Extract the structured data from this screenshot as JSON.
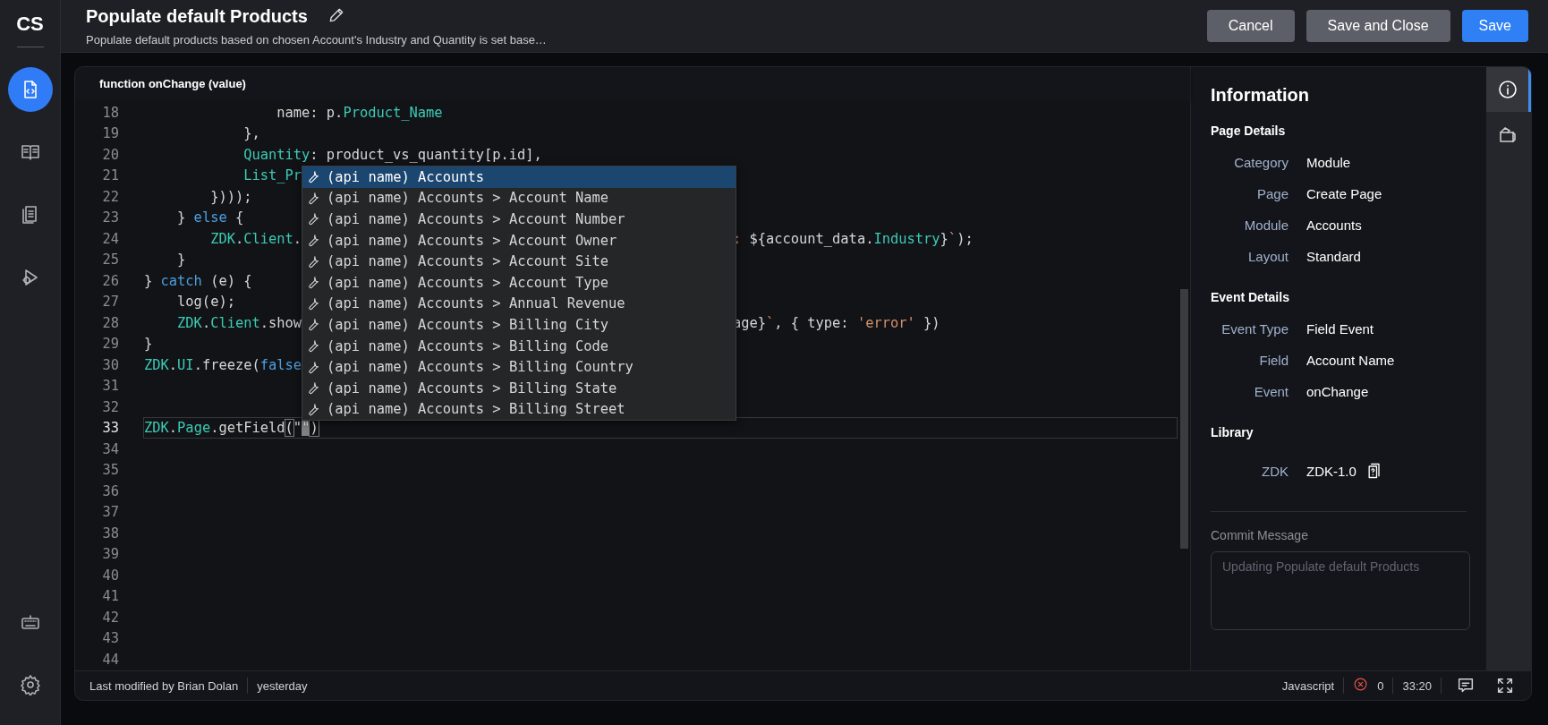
{
  "sidebar": {
    "logo": "CS",
    "items": [
      {
        "kind": "code",
        "selected": true
      },
      {
        "kind": "book",
        "selected": false
      },
      {
        "kind": "list",
        "selected": false
      },
      {
        "kind": "debug",
        "selected": false
      }
    ],
    "bottom_items": [
      {
        "kind": "keyboard"
      },
      {
        "kind": "settings"
      }
    ]
  },
  "header": {
    "title": "Populate default Products",
    "subtitle": "Populate default products based on chosen Account's Industry and Quantity is set base…",
    "buttons": [
      {
        "label": "Cancel",
        "kind": "secondary"
      },
      {
        "label": "Save and Close",
        "kind": "secondary"
      },
      {
        "label": "Save",
        "kind": "primary"
      }
    ]
  },
  "editor": {
    "signature": "function onChange (value)",
    "lines": [
      {
        "number": "18",
        "current": false,
        "before": [
          {
            "t": "                name: p.",
            "kind": "plain"
          },
          {
            "t": "Product_Name",
            "kind": "prop"
          }
        ]
      },
      {
        "number": "19",
        "current": false,
        "before": [
          {
            "t": "            },",
            "kind": "plain"
          }
        ]
      },
      {
        "number": "20",
        "current": false,
        "before": [
          {
            "t": "            Quantity",
            "kind": "prop"
          },
          {
            "t": ": product_vs_quantity[p.id],",
            "kind": "plain"
          }
        ]
      },
      {
        "number": "21",
        "current": false,
        "before": [
          {
            "t": "            List_Pr",
            "kind": "prop"
          }
        ]
      },
      {
        "number": "22",
        "current": false,
        "before": [
          {
            "t": "        })));",
            "kind": "plain"
          }
        ]
      },
      {
        "number": "23",
        "current": false,
        "before": [
          {
            "t": "    } ",
            "kind": "plain"
          },
          {
            "t": "else",
            "kind": "keyword"
          },
          {
            "t": " {",
            "kind": "plain"
          }
        ]
      },
      {
        "number": "24",
        "current": false,
        "before": [
          {
            "t": "        ZDK",
            "kind": "prop"
          },
          {
            "t": ".",
            "kind": "plain"
          },
          {
            "t": "Client",
            "kind": "prop"
          },
          {
            "t": ".",
            "kind": "plain"
          }
        ],
        "after": [
          {
            "t": ": ",
            "kind": "string"
          },
          {
            "t": "${account_data.",
            "kind": "plain"
          },
          {
            "t": "Industry",
            "kind": "prop"
          },
          {
            "t": "}",
            "kind": "plain"
          },
          {
            "t": "`",
            "kind": "string"
          },
          {
            "t": ");",
            "kind": "plain"
          }
        ]
      },
      {
        "number": "25",
        "current": false,
        "before": [
          {
            "t": "    }",
            "kind": "plain"
          }
        ]
      },
      {
        "number": "26",
        "current": false,
        "before": [
          {
            "t": "} ",
            "kind": "plain"
          },
          {
            "t": "catch",
            "kind": "keyword"
          },
          {
            "t": " (e) {",
            "kind": "plain"
          }
        ]
      },
      {
        "number": "27",
        "current": false,
        "before": [
          {
            "t": "    log(e);",
            "kind": "plain"
          }
        ]
      },
      {
        "number": "28",
        "current": false,
        "before": [
          {
            "t": "    ZDK",
            "kind": "prop"
          },
          {
            "t": ".",
            "kind": "plain"
          },
          {
            "t": "Client",
            "kind": "prop"
          },
          {
            "t": ".show",
            "kind": "plain"
          }
        ],
        "after": [
          {
            "t": "age}",
            "kind": "plain"
          },
          {
            "t": "`",
            "kind": "string"
          },
          {
            "t": ", { type: ",
            "kind": "plain"
          },
          {
            "t": "'error'",
            "kind": "string"
          },
          {
            "t": " })",
            "kind": "plain"
          }
        ]
      },
      {
        "number": "29",
        "current": false,
        "before": [
          {
            "t": "}",
            "kind": "plain"
          }
        ]
      },
      {
        "number": "30",
        "current": false,
        "before": [
          {
            "t": "ZDK",
            "kind": "prop"
          },
          {
            "t": ".",
            "kind": "plain"
          },
          {
            "t": "UI",
            "kind": "prop"
          },
          {
            "t": ".freeze(",
            "kind": "plain"
          },
          {
            "t": "false",
            "kind": "keyword"
          }
        ]
      },
      {
        "number": "31",
        "current": false
      },
      {
        "number": "32",
        "current": false
      },
      {
        "number": "33",
        "current": true,
        "before": [
          {
            "t": "ZDK",
            "kind": "prop"
          },
          {
            "t": ".",
            "kind": "plain"
          },
          {
            "t": "Page",
            "kind": "prop"
          },
          {
            "t": ".getField",
            "kind": "plain"
          },
          {
            "t": "(",
            "kind": "bracket"
          },
          {
            "t": "\"",
            "kind": "plain"
          },
          {
            "t": "\"",
            "kind": "cursor"
          },
          {
            "t": ")",
            "kind": "bracket"
          }
        ]
      },
      {
        "number": "34",
        "current": false
      },
      {
        "number": "35",
        "current": false
      },
      {
        "number": "36",
        "current": false
      },
      {
        "number": "37",
        "current": false
      },
      {
        "number": "38",
        "current": false
      },
      {
        "number": "39",
        "current": false
      },
      {
        "number": "40",
        "current": false
      },
      {
        "number": "41",
        "current": false
      },
      {
        "number": "42",
        "current": false
      },
      {
        "number": "43",
        "current": false
      },
      {
        "number": "44",
        "current": false
      }
    ],
    "autocomplete": {
      "items": [
        {
          "text": "(api name) Accounts",
          "selected": true
        },
        {
          "text": "(api name) Accounts > Account Name",
          "selected": false
        },
        {
          "text": "(api name) Accounts > Account Number",
          "selected": false
        },
        {
          "text": "(api name) Accounts > Account Owner",
          "selected": false
        },
        {
          "text": "(api name) Accounts > Account Site",
          "selected": false
        },
        {
          "text": "(api name) Accounts > Account Type",
          "selected": false
        },
        {
          "text": "(api name) Accounts > Annual Revenue",
          "selected": false
        },
        {
          "text": "(api name) Accounts > Billing City",
          "selected": false
        },
        {
          "text": "(api name) Accounts > Billing Code",
          "selected": false
        },
        {
          "text": "(api name) Accounts > Billing Country",
          "selected": false
        },
        {
          "text": "(api name) Accounts > Billing State",
          "selected": false
        },
        {
          "text": "(api name) Accounts > Billing Street",
          "selected": false
        }
      ]
    }
  },
  "info_panel": {
    "title": "Information",
    "sections": [
      {
        "heading": "Page Details",
        "rows": [
          {
            "label": "Category",
            "value": "Module"
          },
          {
            "label": "Page",
            "value": "Create Page"
          },
          {
            "label": "Module",
            "value": "Accounts"
          },
          {
            "label": "Layout",
            "value": "Standard"
          }
        ]
      },
      {
        "heading": "Event Details",
        "rows": [
          {
            "label": "Event Type",
            "value": "Field Event"
          },
          {
            "label": "Field",
            "value": "Account Name"
          },
          {
            "label": "Event",
            "value": "onChange"
          }
        ]
      },
      {
        "heading": "Library",
        "rows": [
          {
            "label": "ZDK",
            "value": "ZDK-1.0",
            "help": true
          }
        ]
      }
    ],
    "commit_label": "Commit Message",
    "commit_placeholder": "Updating Populate default Products",
    "tabs": [
      {
        "kind": "info",
        "selected": true
      },
      {
        "kind": "package",
        "selected": false
      }
    ]
  },
  "status_bar": {
    "modified": "Last modified by Brian Dolan",
    "time": "yesterday",
    "language": "Javascript",
    "errors": "0",
    "position": "33:20"
  }
}
